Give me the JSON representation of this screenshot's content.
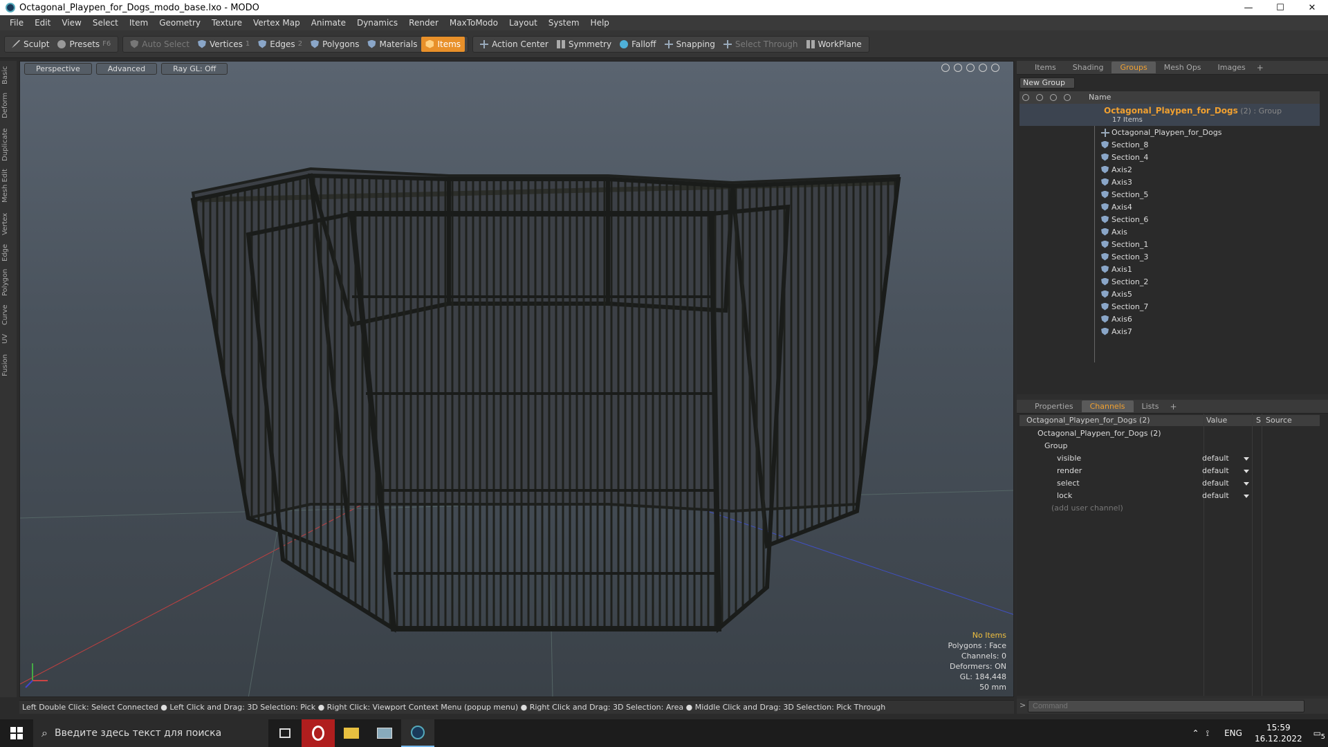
{
  "window": {
    "title": "Octagonal_Playpen_for_Dogs_modo_base.lxo - MODO",
    "minimize": "—",
    "maximize": "☐",
    "close": "✕"
  },
  "menu": [
    "File",
    "Edit",
    "View",
    "Select",
    "Item",
    "Geometry",
    "Texture",
    "Vertex Map",
    "Animate",
    "Dynamics",
    "Render",
    "MaxToModo",
    "Layout",
    "System",
    "Help"
  ],
  "toolbar": {
    "sculpt": "Sculpt",
    "presets": "Presets",
    "presets_key": "F6",
    "auto_select": "Auto Select",
    "vertices": "Vertices",
    "vertices_key": "1",
    "edges": "Edges",
    "edges_key": "2",
    "polygons": "Polygons",
    "materials": "Materials",
    "items": "Items",
    "action_center": "Action Center",
    "symmetry": "Symmetry",
    "falloff": "Falloff",
    "snapping": "Snapping",
    "select_through": "Select Through",
    "workplane": "WorkPlane"
  },
  "left_tabs": [
    "Basic",
    "Deform",
    "Duplicate",
    "Mesh Edit",
    "Vertex",
    "Edge",
    "Polygon",
    "Curve",
    "UV",
    "Fusion"
  ],
  "viewport": {
    "perspective": "Perspective",
    "advanced": "Advanced",
    "raygl": "Ray GL: Off",
    "info": {
      "no_items": "No Items",
      "polygons": "Polygons : Face",
      "channels": "Channels: 0",
      "deformers": "Deformers: ON",
      "gl": "GL: 184,448",
      "scale": "50 mm"
    }
  },
  "statusbar": "Left Double Click: Select Connected ● Left Click and Drag: 3D Selection: Pick ● Right Click: Viewport Context Menu (popup menu) ● Right Click and Drag: 3D Selection: Area ● Middle Click and Drag: 3D Selection: Pick Through",
  "top_tabs": [
    "Items",
    "Shading",
    "Groups",
    "Mesh Ops",
    "Images"
  ],
  "groups": {
    "new_group": "New Group",
    "col_name": "Name",
    "group_name": "Octagonal_Playpen_for_Dogs",
    "group_suffix": " (2) : Group",
    "group_count": "17 Items",
    "items": [
      "Octagonal_Playpen_for_Dogs",
      "Section_8",
      "Section_4",
      "Axis2",
      "Axis3",
      "Section_5",
      "Axis4",
      "Section_6",
      "Axis",
      "Section_1",
      "Section_3",
      "Axis1",
      "Section_2",
      "Axis5",
      "Section_7",
      "Axis6",
      "Axis7"
    ]
  },
  "bottom_tabs": [
    "Properties",
    "Channels",
    "Lists"
  ],
  "channels": {
    "header_name": "Octagonal_Playpen_for_Dogs (2)",
    "header_value": "Value",
    "header_s": "S",
    "header_source": "Source",
    "root": "Octagonal_Playpen_for_Dogs (2)",
    "group": "Group",
    "rows": [
      {
        "name": "visible",
        "value": "default"
      },
      {
        "name": "render",
        "value": "default"
      },
      {
        "name": "select",
        "value": "default"
      },
      {
        "name": "lock",
        "value": "default"
      }
    ],
    "add_user_channel": "(add user channel)"
  },
  "command_placeholder": "Command",
  "taskbar": {
    "search": "Введите здесь текст для поиска",
    "lang": "ENG",
    "time": "15:59",
    "date": "16.12.2022",
    "notif_count": "5"
  },
  "colors": {
    "accent": "#e8902a",
    "group_name": "#f0a030"
  }
}
